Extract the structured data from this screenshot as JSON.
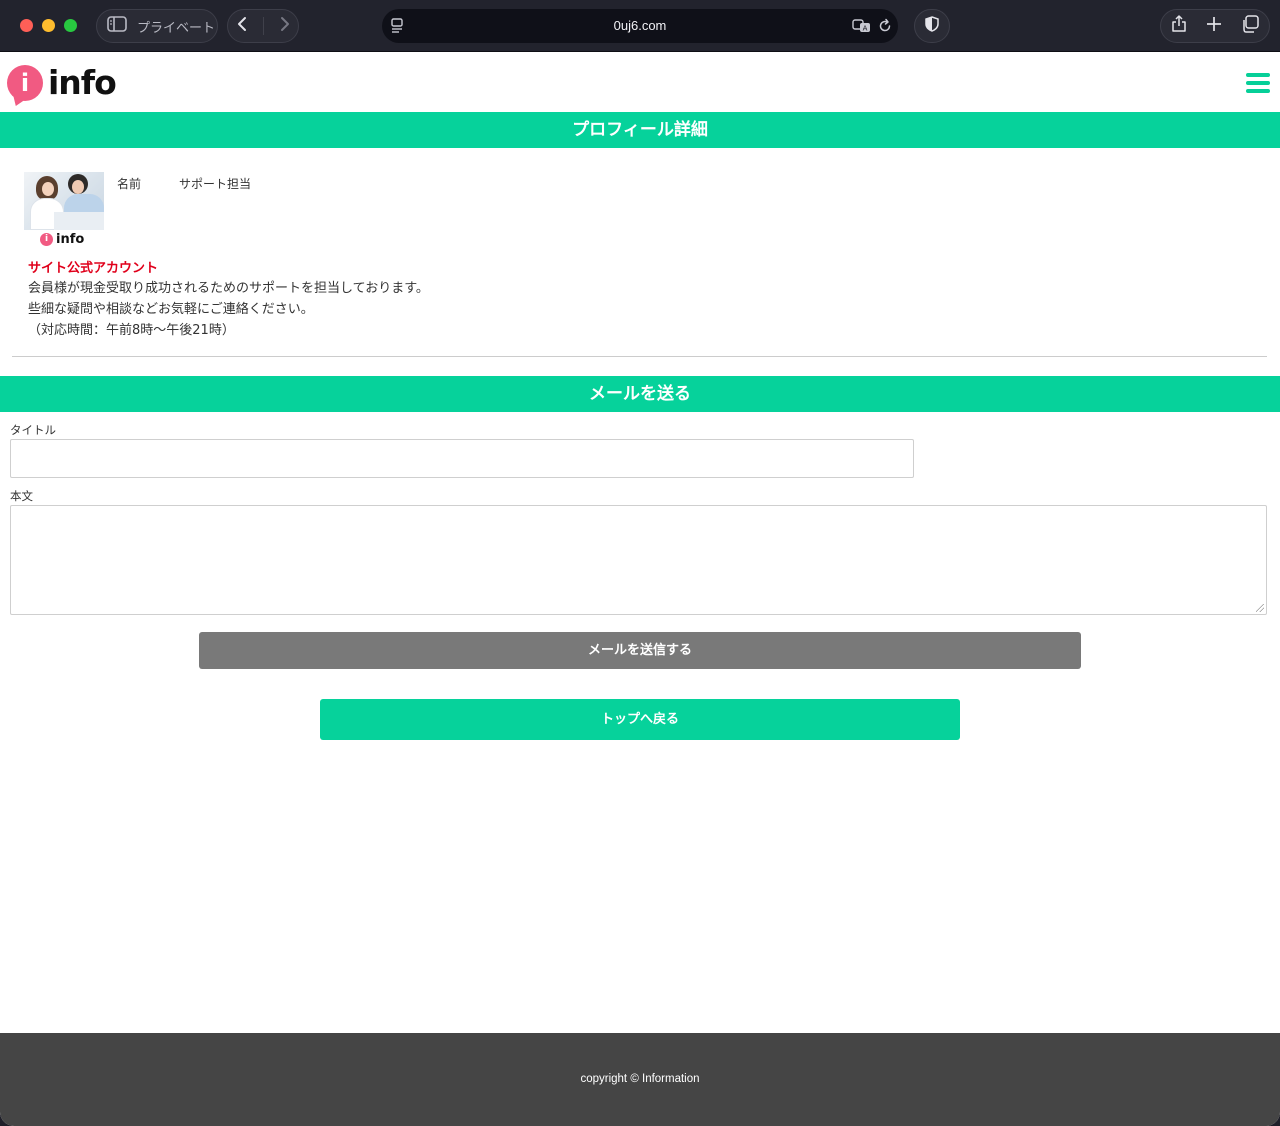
{
  "browser": {
    "private_label": "プライベート",
    "url": "0uj6.com"
  },
  "header": {
    "logo_text": "info",
    "logo_letter": "i"
  },
  "profile": {
    "section_title": "プロフィール詳細",
    "name_label": "名前",
    "name_value": "サポート担当",
    "mini_logo_text": "info",
    "official_label": "サイト公式アカウント",
    "description": [
      "会員様が現金受取り成功されるためのサポートを担当しております。",
      "些細な疑問や相談などお気軽にご連絡ください。",
      "（対応時間：午前8時〜午後21時）"
    ]
  },
  "mail": {
    "section_title": "メールを送る",
    "title_label": "タイトル",
    "title_value": "",
    "body_label": "本文",
    "body_value": "",
    "send_button": "メールを送信する",
    "back_button": "トップへ戻る"
  },
  "footer": {
    "copyright": "copyright © Information"
  },
  "colors": {
    "accent": "#06d29b",
    "official": "#e0001b",
    "logo_pink": "#f15a82",
    "send_button": "#797979",
    "footer_bg": "#454545"
  }
}
